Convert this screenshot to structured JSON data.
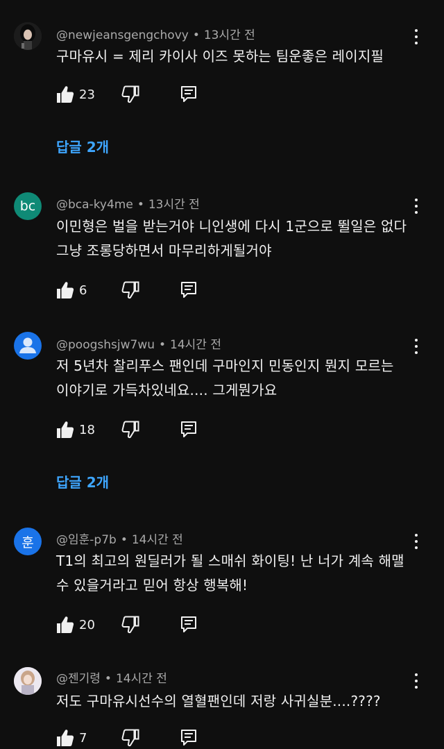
{
  "comments": [
    {
      "author": "@newjeansgengchovy",
      "time": "13시간 전",
      "avatar_text": "",
      "text": "구마유시 = 제리 카이사 이즈 못하는 팀운좋은 레이지필",
      "likes": "23",
      "replies": "답글 2개"
    },
    {
      "author": "@bca-ky4me",
      "time": "13시간 전",
      "avatar_text": "bc",
      "avatar_color": "#0f8a76",
      "text": "이민형은 벌을 받는거야 니인생에 다시 1군으로 뛸일은 없다 그냥 조롱당하면서 마무리하게될거야",
      "likes": "6"
    },
    {
      "author": "@poogshsjw7wu",
      "time": "14시간 전",
      "avatar_text": "",
      "avatar_color": "#1a73e8",
      "text": "저 5년차 찰리푸스 팬인데 구마인지 민동인지 뭔지 모르는 이야기로 가득차있네요.... 그게뭔가요",
      "likes": "18",
      "replies": "답글 2개"
    },
    {
      "author": "@임훈-p7b",
      "time": "14시간 전",
      "avatar_text": "훈",
      "avatar_color": "#1a73e8",
      "text": "T1의 최고의 원딜러가 될 스매쉬 화이팅! 난 너가 계속 해맬수 있을거라고 믿어 항상 행복해!",
      "likes": "20"
    },
    {
      "author": "@젠기령",
      "time": "14시간 전",
      "avatar_text": "",
      "text": "저도 구마유시선수의 열혈팬인데 저랑 사귀실분....????",
      "likes": "7"
    }
  ],
  "icons": {
    "like": "thumb-up-icon",
    "dislike": "thumb-down-icon",
    "reply": "reply-comment-icon",
    "more": "more-vert-icon"
  },
  "colors": {
    "background": "#0f0f0f",
    "link": "#3ea6ff",
    "secondary_text": "#aaaaaa"
  }
}
